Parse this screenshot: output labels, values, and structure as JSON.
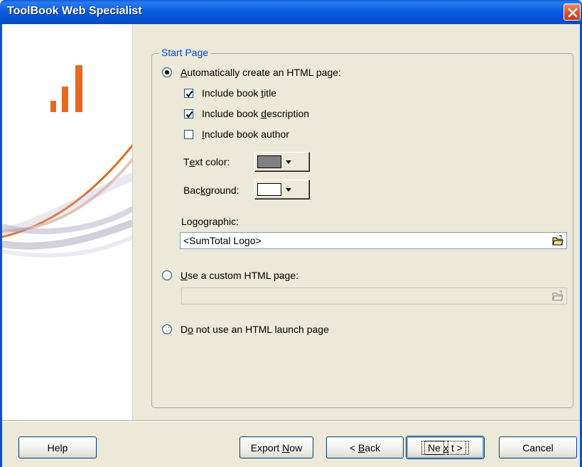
{
  "window": {
    "title": "ToolBook Web Specialist",
    "close_icon": "close-icon"
  },
  "group": {
    "legend": "Start Page"
  },
  "options": {
    "auto_create": {
      "pre": "",
      "ul": "A",
      "post": "utomatically create an HTML page:",
      "selected": true
    },
    "include_title": {
      "pre": "Include book ",
      "ul": "t",
      "post": "itle",
      "checked": true
    },
    "include_description": {
      "pre": "Include book ",
      "ul": "d",
      "post": "escription",
      "checked": true
    },
    "include_author": {
      "pre": "",
      "ul": "I",
      "post": "nclude book author",
      "checked": false
    },
    "text_color": {
      "pre": "T",
      "ul": "e",
      "post": "xt color:",
      "swatch": "#808080"
    },
    "background": {
      "pre": "Bac",
      "ul": "k",
      "post": "ground:",
      "swatch": "#ffffff"
    },
    "logo_graphic": {
      "pre": "Logo ",
      "ul": "g",
      "post": "raphic:",
      "value": "<SumTotal Logo>"
    },
    "custom_page": {
      "pre": "",
      "ul": "U",
      "post": "se a custom HTML page:",
      "selected": false,
      "value": ""
    },
    "no_launch": {
      "pre": "D",
      "ul": "o",
      "post": " not use an HTML launch page",
      "selected": false
    }
  },
  "buttons": {
    "help": "Help",
    "export_now": {
      "pre": "Export ",
      "ul": "N",
      "post": "ow"
    },
    "back": {
      "pre": "< ",
      "ul": "B",
      "post": "ack"
    },
    "next": {
      "pre": "Ne",
      "ul": "x",
      "post": "t >"
    },
    "cancel": "Cancel"
  },
  "colors": {
    "accent_orange": "#e8691e",
    "titlebar_blue": "#0a5bd8"
  }
}
